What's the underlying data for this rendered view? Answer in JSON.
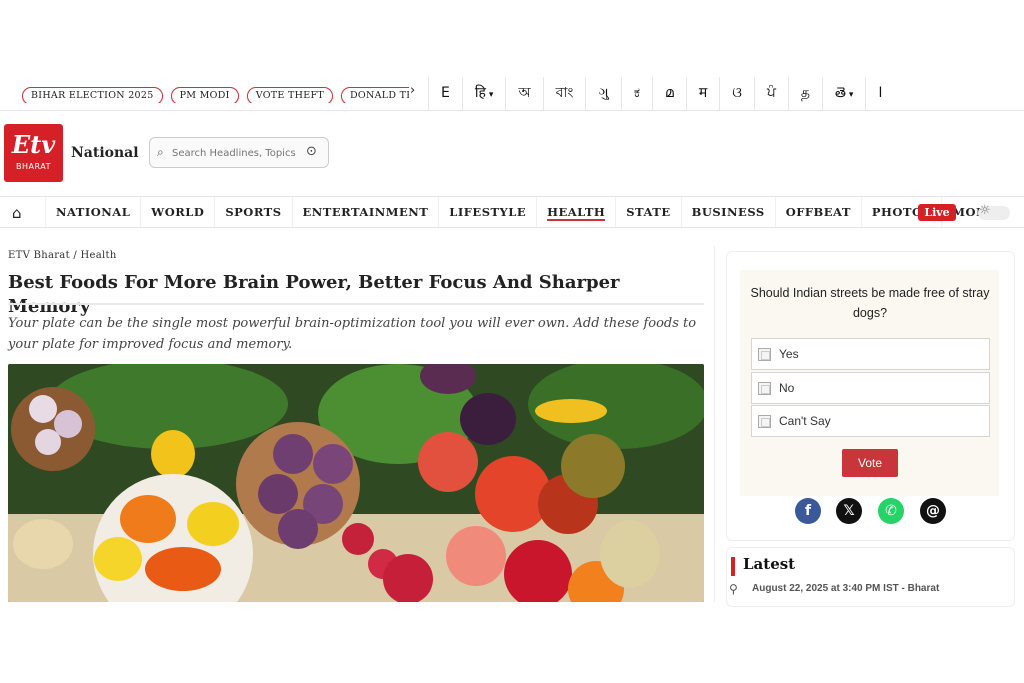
{
  "topbar": {
    "trending": [
      "BIHAR ELECTION 2025",
      "PM MODI",
      "VOTE THEFT",
      "DONALD TRUMP"
    ],
    "next_symbol": "›",
    "languages": [
      {
        "label": "E",
        "dropdown": false
      },
      {
        "label": "हि",
        "dropdown": true
      },
      {
        "label": "অ",
        "dropdown": false
      },
      {
        "label": "বাং",
        "dropdown": false
      },
      {
        "label": "ગુ",
        "dropdown": false
      },
      {
        "label": "ಕ",
        "dropdown": false
      },
      {
        "label": "മ",
        "dropdown": false
      },
      {
        "label": "म",
        "dropdown": false
      },
      {
        "label": "ଓ",
        "dropdown": false
      },
      {
        "label": "ਪੰ",
        "dropdown": false
      },
      {
        "label": "த",
        "dropdown": false
      },
      {
        "label": "తె",
        "dropdown": true
      },
      {
        "label": "ا",
        "dropdown": false
      }
    ]
  },
  "header": {
    "logo_text": "Etv",
    "logo_sub": "BHARAT",
    "edition": "National",
    "search_placeholder": "Search Headlines, Topics"
  },
  "nav": {
    "items": [
      "NATIONAL",
      "WORLD",
      "SPORTS",
      "ENTERTAINMENT",
      "LIFESTYLE",
      "HEALTH",
      "STATE",
      "BUSINESS",
      "OFFBEAT",
      "PHOTOS",
      "MORE"
    ],
    "active": "HEALTH",
    "live_label": "Live"
  },
  "article": {
    "breadcrumb": "ETV Bharat / Health",
    "headline": "Best Foods For More Brain Power, Better Focus And Sharper Memory",
    "summary": "Your plate can be the single most powerful brain-optimization tool you will ever own. Add these foods to your plate for improved focus and memory."
  },
  "poll": {
    "question": "Should Indian streets be made free of stray dogs?",
    "options": [
      "Yes",
      "No",
      "Can't Say"
    ],
    "vote_label": "Vote"
  },
  "share": [
    {
      "name": "facebook",
      "glyph": "f",
      "color": "#3b5998"
    },
    {
      "name": "x",
      "glyph": "𝕏",
      "color": "#111111"
    },
    {
      "name": "whatsapp",
      "glyph": "✆",
      "color": "#25d366"
    },
    {
      "name": "threads",
      "glyph": "@",
      "color": "#111111"
    }
  ],
  "latest": {
    "title": "Latest",
    "meta": "August 22, 2025 at 3:40 PM IST - Bharat"
  },
  "colors": {
    "brand_red": "#d62028",
    "accent_red": "#c9353b"
  }
}
